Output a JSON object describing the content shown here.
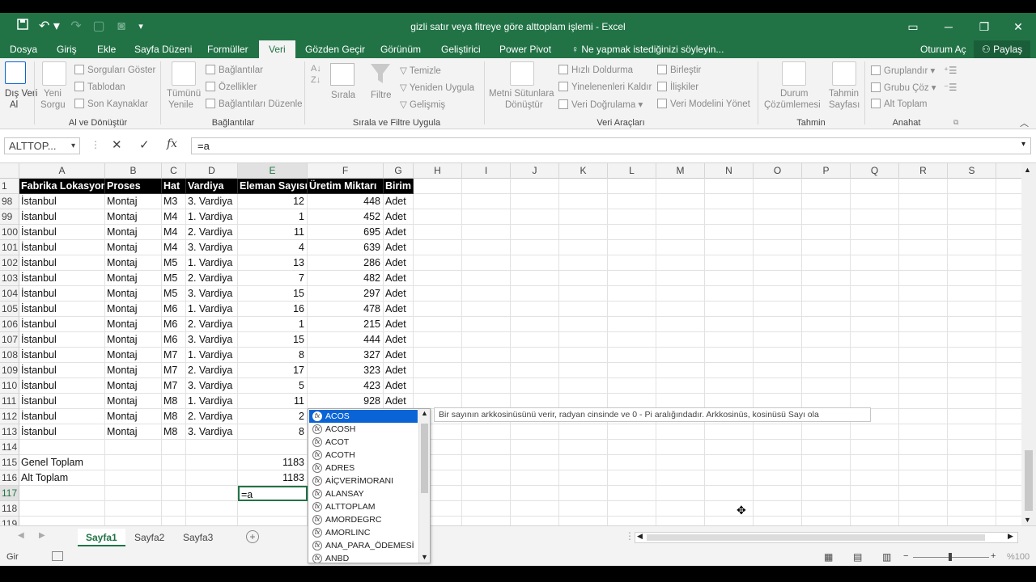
{
  "window": {
    "title": "gizli satır veya fitreye göre alttoplam işlemi - Excel"
  },
  "menu_tabs": [
    "Dosya",
    "Giriş",
    "Ekle",
    "Sayfa Düzeni",
    "Formüller",
    "Veri",
    "Gözden Geçir",
    "Görünüm",
    "Geliştirici",
    "Power Pivot"
  ],
  "tell_me": "Ne yapmak istediğinizi söyleyin...",
  "account": {
    "signin": "Oturum Aç",
    "share": "Paylaş"
  },
  "ribbon": {
    "ext_data": [
      "Dış Veri",
      "Al"
    ],
    "new_query": [
      "Yeni",
      "Sorgu"
    ],
    "show_queries": "Sorguları Göster",
    "from_table": "Tablodan",
    "recent_sources": "Son Kaynaklar",
    "group_get": "Al ve Dönüştür",
    "refresh_all": [
      "Tümünü",
      "Yenile"
    ],
    "connections": "Bağlantılar",
    "properties": "Özellikler",
    "edit_links": "Bağlantıları Düzenle",
    "group_connections": "Bağlantılar",
    "sort": "Sırala",
    "filter": "Filtre",
    "clear": "Temizle",
    "reapply": "Yeniden Uygula",
    "advanced": "Gelişmiş",
    "group_sort": "Sırala ve Filtre Uygula",
    "text_to_cols": [
      "Metni Sütunlara",
      "Dönüştür"
    ],
    "flash_fill": "Hızlı Doldurma",
    "remove_dup": "Yinelenenleri Kaldır",
    "validation": "Veri Doğrulama",
    "consolidate": "Birleştir",
    "relationships": "İlişkiler",
    "data_model": "Veri Modelini Yönet",
    "group_tools": "Veri Araçları",
    "what_if": [
      "Durum",
      "Çözümlemesi"
    ],
    "forecast": [
      "Tahmin",
      "Sayfası"
    ],
    "group_forecast": "Tahmin",
    "group_btn": "Gruplandır",
    "ungroup": "Grubu Çöz",
    "subtotal": "Alt Toplam",
    "group_outline": "Anahat"
  },
  "formula_bar": {
    "name_box": "ALTTOP...",
    "formula": "=a"
  },
  "columns": [
    "A",
    "B",
    "C",
    "D",
    "E",
    "F",
    "G",
    "H",
    "I",
    "J",
    "K",
    "L",
    "M",
    "N",
    "O",
    "P",
    "Q",
    "R",
    "S"
  ],
  "header_row": {
    "row": "1",
    "cells": [
      "Fabrika Lokasyon",
      "Proses",
      "Hat",
      "Vardiya",
      "Eleman Sayısı",
      "Üretim Miktarı",
      "Birim"
    ]
  },
  "rows": [
    {
      "row": "98",
      "a": "İstanbul",
      "b": "Montaj",
      "c": "M3",
      "d": "3. Vardiya",
      "e": "12",
      "f": "448",
      "g": "Adet"
    },
    {
      "row": "99",
      "a": "İstanbul",
      "b": "Montaj",
      "c": "M4",
      "d": "1. Vardiya",
      "e": "1",
      "f": "452",
      "g": "Adet"
    },
    {
      "row": "100",
      "a": "İstanbul",
      "b": "Montaj",
      "c": "M4",
      "d": "2. Vardiya",
      "e": "11",
      "f": "695",
      "g": "Adet"
    },
    {
      "row": "101",
      "a": "İstanbul",
      "b": "Montaj",
      "c": "M4",
      "d": "3. Vardiya",
      "e": "4",
      "f": "639",
      "g": "Adet"
    },
    {
      "row": "102",
      "a": "İstanbul",
      "b": "Montaj",
      "c": "M5",
      "d": "1. Vardiya",
      "e": "13",
      "f": "286",
      "g": "Adet"
    },
    {
      "row": "103",
      "a": "İstanbul",
      "b": "Montaj",
      "c": "M5",
      "d": "2. Vardiya",
      "e": "7",
      "f": "482",
      "g": "Adet"
    },
    {
      "row": "104",
      "a": "İstanbul",
      "b": "Montaj",
      "c": "M5",
      "d": "3. Vardiya",
      "e": "15",
      "f": "297",
      "g": "Adet"
    },
    {
      "row": "105",
      "a": "İstanbul",
      "b": "Montaj",
      "c": "M6",
      "d": "1. Vardiya",
      "e": "16",
      "f": "478",
      "g": "Adet"
    },
    {
      "row": "106",
      "a": "İstanbul",
      "b": "Montaj",
      "c": "M6",
      "d": "2. Vardiya",
      "e": "1",
      "f": "215",
      "g": "Adet"
    },
    {
      "row": "107",
      "a": "İstanbul",
      "b": "Montaj",
      "c": "M6",
      "d": "3. Vardiya",
      "e": "15",
      "f": "444",
      "g": "Adet"
    },
    {
      "row": "108",
      "a": "İstanbul",
      "b": "Montaj",
      "c": "M7",
      "d": "1. Vardiya",
      "e": "8",
      "f": "327",
      "g": "Adet"
    },
    {
      "row": "109",
      "a": "İstanbul",
      "b": "Montaj",
      "c": "M7",
      "d": "2. Vardiya",
      "e": "17",
      "f": "323",
      "g": "Adet"
    },
    {
      "row": "110",
      "a": "İstanbul",
      "b": "Montaj",
      "c": "M7",
      "d": "3. Vardiya",
      "e": "5",
      "f": "423",
      "g": "Adet"
    },
    {
      "row": "111",
      "a": "İstanbul",
      "b": "Montaj",
      "c": "M8",
      "d": "1. Vardiya",
      "e": "11",
      "f": "928",
      "g": "Adet"
    },
    {
      "row": "112",
      "a": "İstanbul",
      "b": "Montaj",
      "c": "M8",
      "d": "2. Vardiya",
      "e": "2",
      "f": "",
      "g": ""
    },
    {
      "row": "113",
      "a": "İstanbul",
      "b": "Montaj",
      "c": "M8",
      "d": "3. Vardiya",
      "e": "8",
      "f": "",
      "g": ""
    },
    {
      "row": "114",
      "a": "",
      "b": "",
      "c": "",
      "d": "",
      "e": "",
      "f": "",
      "g": ""
    },
    {
      "row": "115",
      "a": "Genel Toplam",
      "b": "",
      "c": "",
      "d": "",
      "e": "1183",
      "f": "",
      "g": ""
    },
    {
      "row": "116",
      "a": "Alt Toplam",
      "b": "",
      "c": "",
      "d": "",
      "e": "1183",
      "f": "",
      "g": ""
    },
    {
      "row": "117",
      "a": "",
      "b": "",
      "c": "",
      "d": "",
      "e": "=a",
      "f": "",
      "g": ""
    },
    {
      "row": "118",
      "a": "",
      "b": "",
      "c": "",
      "d": "",
      "e": "",
      "f": "",
      "g": ""
    },
    {
      "row": "119",
      "a": "",
      "b": "",
      "c": "",
      "d": "",
      "e": "",
      "f": "",
      "g": ""
    }
  ],
  "autocomplete": [
    "ACOS",
    "ACOSH",
    "ACOT",
    "ACOTH",
    "ADRES",
    "AİÇVERİMORANI",
    "ALANSAY",
    "ALTTOPLAM",
    "AMORDEGRC",
    "AMORLINC",
    "ANA_PARA_ÖDEMESİ",
    "ANBD"
  ],
  "tooltip": "Bir sayının arkkosinüsünü verir, radyan cinsinde ve 0 - Pi aralığındadır. Arkkosinüs, kosinüsü Sayı ola",
  "sheets": [
    "Sayfa1",
    "Sayfa2",
    "Sayfa3"
  ],
  "status": {
    "mode": "Gir",
    "zoom": "%100"
  },
  "colors": {
    "excel_green": "#217346",
    "selection_blue": "#0a64d6"
  }
}
